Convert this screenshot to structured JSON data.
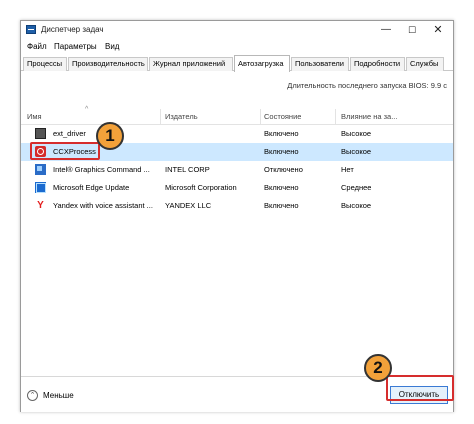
{
  "window": {
    "title": "Диспетчер задач"
  },
  "titlebar": {
    "minimize": "—",
    "maximize": "☐",
    "close": "✕"
  },
  "menu": [
    "Файл",
    "Параметры",
    "Вид"
  ],
  "tabs": [
    {
      "label": "Процессы",
      "active": false
    },
    {
      "label": "Производительность",
      "active": false
    },
    {
      "label": "Журнал приложений",
      "active": false
    },
    {
      "label": "Автозагрузка",
      "active": true
    },
    {
      "label": "Пользователи",
      "active": false
    },
    {
      "label": "Подробности",
      "active": false
    },
    {
      "label": "Службы",
      "active": false
    }
  ],
  "bios": {
    "label": "Длительность последнего запуска BIOS:",
    "value": "9.9 с"
  },
  "table": {
    "sort_indicator": "^",
    "columns": [
      "Имя",
      "Издатель",
      "Состояние",
      "Влияние на за..."
    ],
    "rows": [
      {
        "icon": "driver-icon",
        "name": "ext_driver",
        "publisher": "",
        "status": "Включено",
        "impact": "Высокое",
        "selected": false
      },
      {
        "icon": "ccx-icon",
        "name": "CCXProcess",
        "publisher": "",
        "status": "Включено",
        "impact": "Высокое",
        "selected": true
      },
      {
        "icon": "intel-icon",
        "name": "Intel® Graphics Command ...",
        "publisher": "INTEL CORP",
        "status": "Отключено",
        "impact": "Нет",
        "selected": false
      },
      {
        "icon": "edge-icon",
        "name": "Microsoft Edge Update",
        "publisher": "Microsoft Corporation",
        "status": "Включено",
        "impact": "Среднее",
        "selected": false
      },
      {
        "icon": "yandex-icon",
        "name": "Yandex with voice assistant ...",
        "publisher": "YANDEX LLC",
        "status": "Включено",
        "impact": "Высокое",
        "selected": false
      }
    ]
  },
  "footer": {
    "less_label": "Меньше",
    "less_glyph": "⌃",
    "disable_label": "Отключить"
  },
  "callouts": {
    "one": "1",
    "two": "2"
  },
  "icons": {
    "yandex_glyph": "Y"
  },
  "colors": {
    "selected_row": "#cde8ff",
    "callout": "#f2a13a",
    "highlight": "#d62d2d",
    "accent": "#3a7ad4"
  }
}
